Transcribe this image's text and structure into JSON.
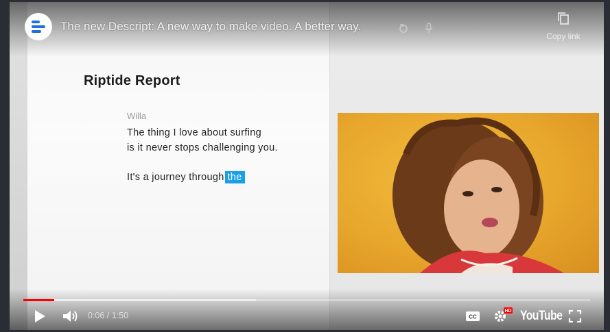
{
  "video": {
    "title": "The new Descript: A new way to make video. A better way.",
    "copy_link_label": "Copy link"
  },
  "document": {
    "title": "Riptide Report",
    "speaker": "Willa",
    "line1": "The thing I love about surfing",
    "line2": "is it never stops challenging you.",
    "line3_text": "It's a journey through",
    "line3_highlight": "the"
  },
  "controls": {
    "time": "0:06 / 1:50",
    "progress_fraction": 0.054,
    "buffer_fraction": 0.41,
    "brand": "YouTube",
    "hd_badge": "HD"
  },
  "colors": {
    "progress": "#ff0000",
    "highlight": "#18a0ea"
  }
}
